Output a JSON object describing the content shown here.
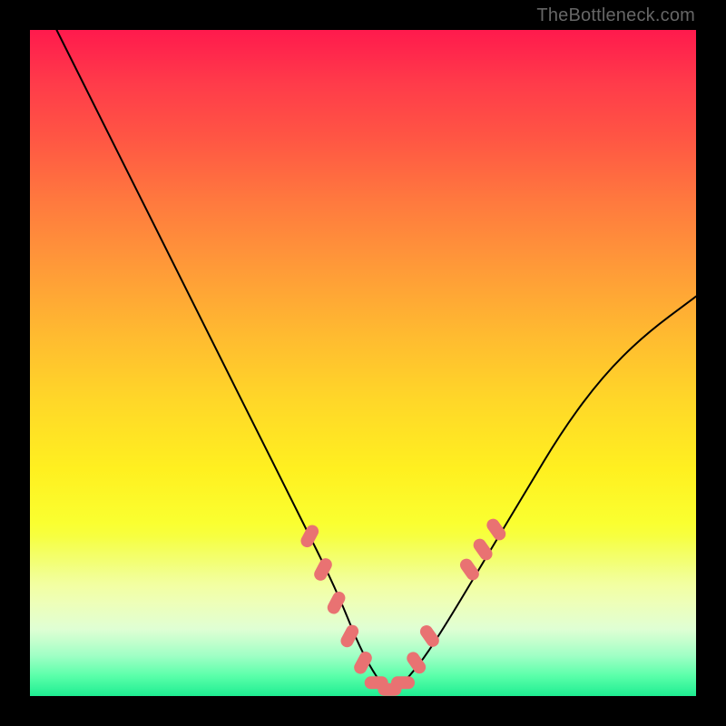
{
  "attribution": "TheBottleneck.com",
  "chart_data": {
    "type": "line",
    "title": "",
    "xlabel": "",
    "ylabel": "",
    "xlim": [
      0,
      100
    ],
    "ylim": [
      0,
      100
    ],
    "series": [
      {
        "name": "curve",
        "x": [
          4,
          10,
          16,
          22,
          28,
          34,
          40,
          46,
          50,
          54,
          58,
          62,
          68,
          74,
          80,
          86,
          92,
          100
        ],
        "y": [
          100,
          88,
          76,
          64,
          52,
          40,
          28,
          16,
          6,
          0,
          4,
          10,
          20,
          30,
          40,
          48,
          54,
          60
        ]
      }
    ],
    "markers": {
      "name": "highlighted-points",
      "color": "#e97272",
      "points": [
        {
          "x": 42,
          "y": 24
        },
        {
          "x": 44,
          "y": 19
        },
        {
          "x": 46,
          "y": 14
        },
        {
          "x": 48,
          "y": 9
        },
        {
          "x": 50,
          "y": 5
        },
        {
          "x": 52,
          "y": 2
        },
        {
          "x": 54,
          "y": 1
        },
        {
          "x": 56,
          "y": 2
        },
        {
          "x": 58,
          "y": 5
        },
        {
          "x": 60,
          "y": 9
        },
        {
          "x": 66,
          "y": 19
        },
        {
          "x": 68,
          "y": 22
        },
        {
          "x": 70,
          "y": 25
        }
      ]
    },
    "gradient_stops": [
      {
        "pos": 0,
        "color": "#ff1a4d"
      },
      {
        "pos": 50,
        "color": "#ffd828"
      },
      {
        "pos": 100,
        "color": "#00e886"
      }
    ]
  }
}
